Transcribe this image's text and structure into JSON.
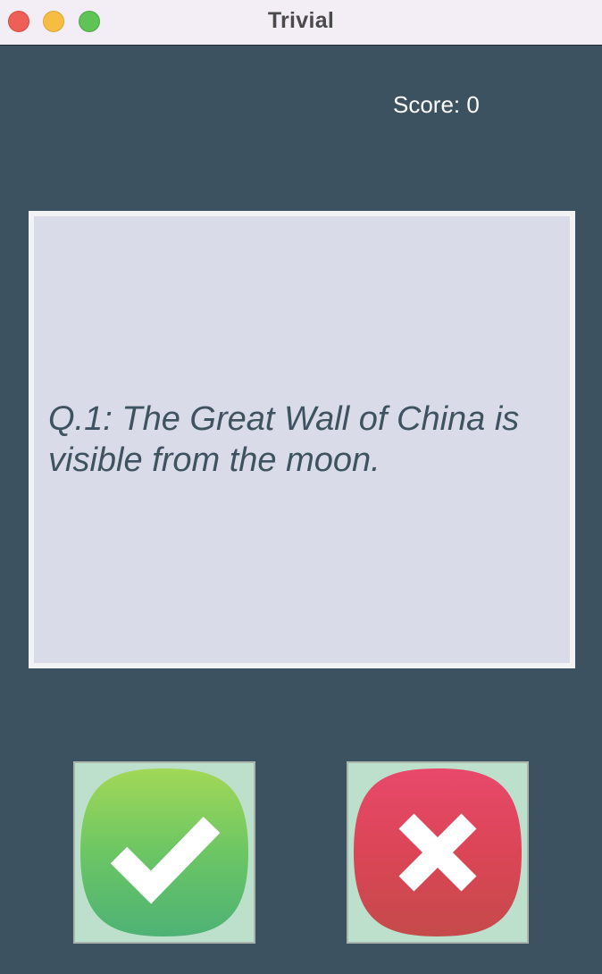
{
  "window": {
    "title": "Trivial",
    "controls": {
      "close_color": "#ee5f57",
      "minimize_color": "#f5bd41",
      "maximize_color": "#5fc454"
    }
  },
  "score": {
    "label": "Score: 0"
  },
  "question": {
    "text": "Q.1: The Great Wall of China is visible from the moon."
  },
  "answers": {
    "true_button": {
      "icon": "checkmark-icon",
      "color": "#5cc46a"
    },
    "false_button": {
      "icon": "cross-icon",
      "color": "#e0485f"
    }
  },
  "colors": {
    "background": "#3d5260",
    "card": "#d9dce8",
    "question_text": "#3f5260"
  }
}
